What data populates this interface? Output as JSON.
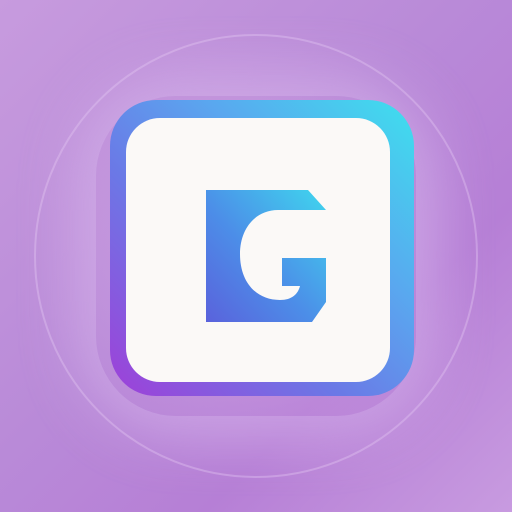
{
  "logo": {
    "letter": "G",
    "icon": "letter-g-app-icon"
  },
  "colors": {
    "background": "#c08fdc",
    "frame_gradient": [
      "#3ee0ee",
      "#5aa6ef",
      "#6b78e6",
      "#9f3fd8"
    ],
    "face": "#fbf9f7",
    "glyph_gradient": [
      "#3fd6ee",
      "#4c8ee8",
      "#5a62dc"
    ]
  }
}
